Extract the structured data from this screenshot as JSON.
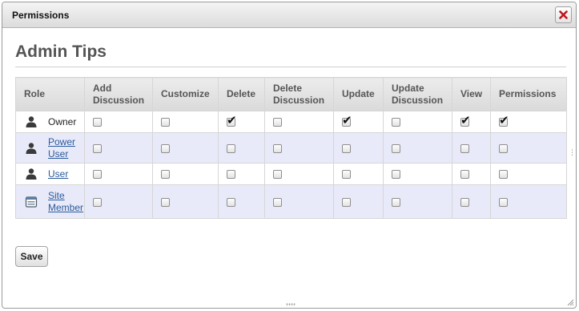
{
  "window": {
    "title": "Permissions",
    "close_icon": "close-icon (red x)"
  },
  "page": {
    "heading": "Admin Tips"
  },
  "table": {
    "columns": [
      "Role",
      "Add Discussion",
      "Customize",
      "Delete",
      "Delete Discussion",
      "Update",
      "Update Discussion",
      "View",
      "Permissions"
    ],
    "rows": [
      {
        "role": "Owner",
        "icon": "user-icon",
        "link": false,
        "checked": [
          false,
          false,
          true,
          false,
          true,
          false,
          true,
          true
        ]
      },
      {
        "role": "Power User",
        "icon": "user-icon",
        "link": true,
        "checked": [
          false,
          false,
          false,
          false,
          false,
          false,
          false,
          false
        ]
      },
      {
        "role": "User",
        "icon": "user-icon",
        "link": true,
        "checked": [
          false,
          false,
          false,
          false,
          false,
          false,
          false,
          false
        ]
      },
      {
        "role": "Site Member",
        "icon": "site-member-icon",
        "link": true,
        "checked": [
          false,
          false,
          false,
          false,
          false,
          false,
          false,
          false
        ]
      }
    ]
  },
  "actions": {
    "save_label": "Save"
  },
  "colors": {
    "link": "#2a5b9b",
    "alt_row": "#e9eaf9",
    "close_x": "#c0161c"
  }
}
